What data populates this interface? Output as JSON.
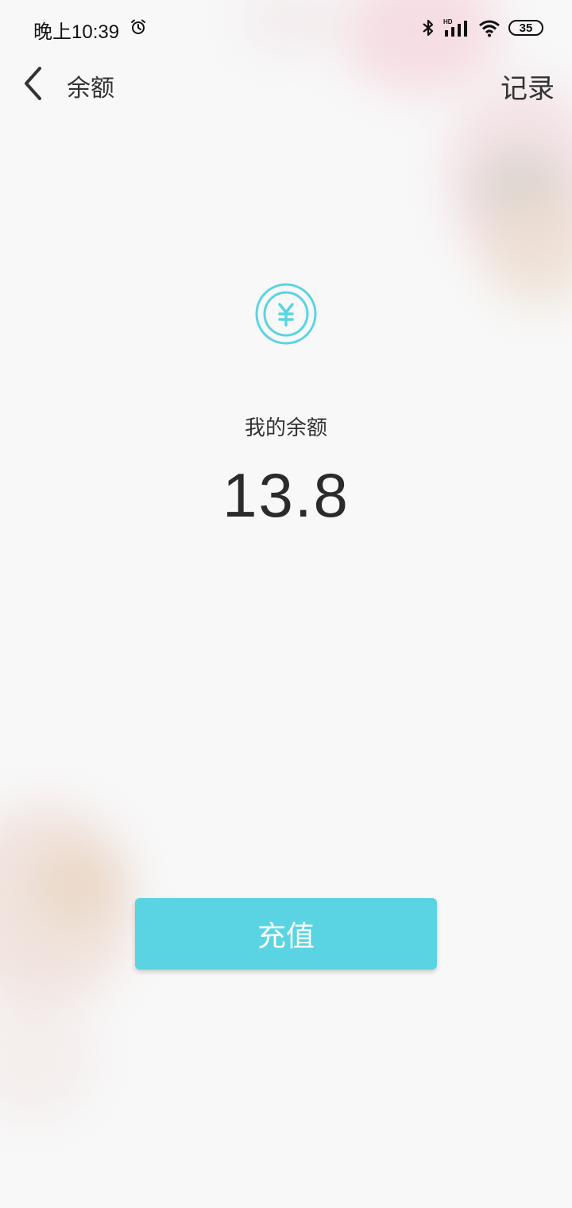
{
  "status_bar": {
    "time": "晚上10:39",
    "battery": "35",
    "icons": [
      "alarm-icon",
      "bluetooth-icon",
      "hd-signal-icon",
      "wifi-icon",
      "battery-icon"
    ]
  },
  "nav": {
    "title": "余额",
    "records_label": "记录",
    "back_icon": "chevron-left-icon"
  },
  "balance": {
    "icon": "yuan-coin-icon",
    "label": "我的余额",
    "amount": "13.8"
  },
  "actions": {
    "recharge_label": "充值"
  },
  "colors": {
    "accent": "#5ad4e3",
    "background": "#f8f8f8",
    "text": "#333333"
  }
}
